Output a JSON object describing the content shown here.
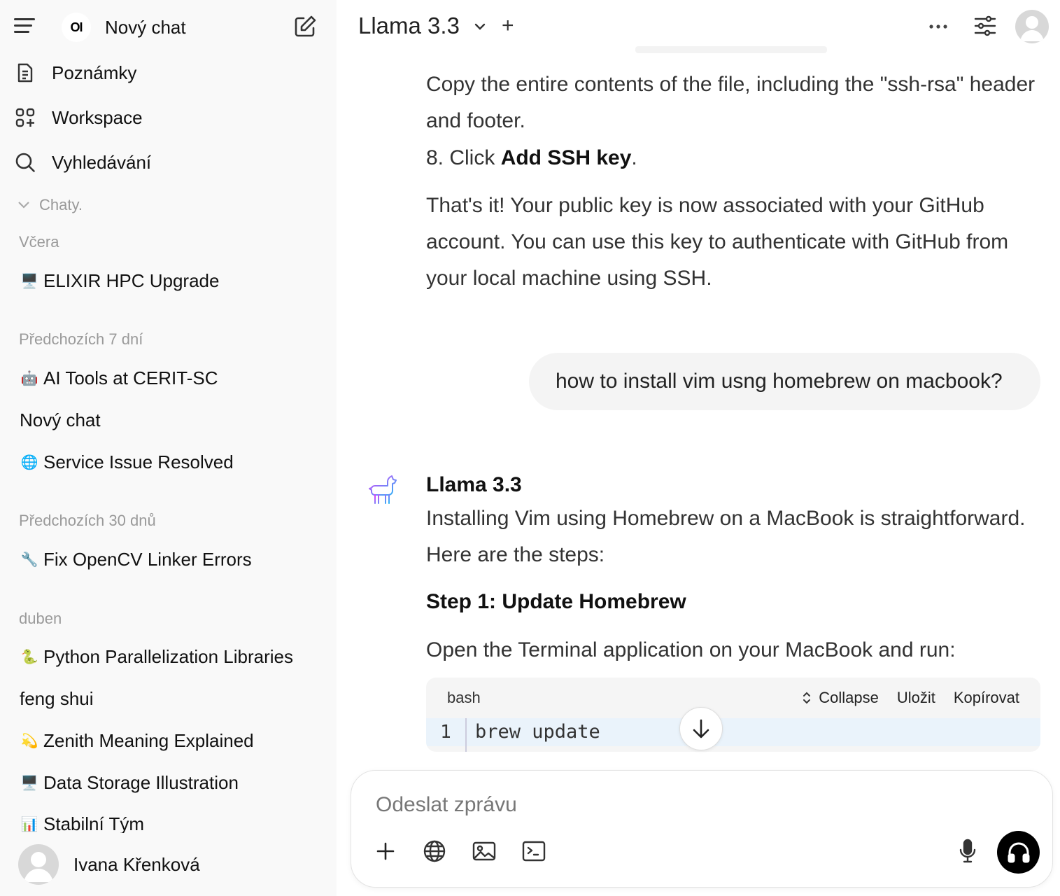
{
  "sidebar": {
    "new_chat_label": "Nový chat",
    "logo_text": "OI",
    "nav": [
      {
        "label": "Poznámky"
      },
      {
        "label": "Workspace"
      },
      {
        "label": "Vyhledávání"
      }
    ],
    "chats_label": "Chaty.",
    "groups": [
      {
        "label": "Včera"
      },
      {
        "label": "Předchozích 7 dní"
      },
      {
        "label": "Předchozích 30 dnů"
      },
      {
        "label": "duben"
      }
    ],
    "chats": [
      {
        "emoji": "🖥️",
        "title": "ELIXIR HPC Upgrade"
      },
      {
        "emoji": "🤖",
        "title": "AI Tools at CERIT-SC"
      },
      {
        "emoji": "",
        "title": "Nový chat"
      },
      {
        "emoji": "🌐",
        "title": "Service Issue Resolved"
      },
      {
        "emoji": "🔧",
        "title": "Fix OpenCV Linker Errors"
      },
      {
        "emoji": "🐍",
        "title": "Python Parallelization Libraries"
      },
      {
        "emoji": "",
        "title": "feng shui"
      },
      {
        "emoji": "💫",
        "title": "Zenith Meaning Explained"
      },
      {
        "emoji": "🖥️",
        "title": "Data Storage Illustration"
      },
      {
        "emoji": "📊",
        "title": "Stabilní Tým"
      }
    ],
    "user_name": "Ivana Křenková"
  },
  "header": {
    "model": "Llama 3.3"
  },
  "conversation": {
    "prev_para1": "Copy the entire contents of the file, including the \"ssh-rsa\" header and footer.",
    "prev_step8_prefix": "8. Click ",
    "prev_step8_bold": "Add SSH key",
    "prev_step8_suffix": ".",
    "prev_para2": "That's it! Your public key is now associated with your GitHub account. You can use this key to authenticate with GitHub from your local machine using SSH.",
    "user_message": "how to install vim usng homebrew on macbook?",
    "assistant_name": "Llama 3.3",
    "assistant_intro": "Installing Vim using Homebrew on a MacBook is straightforward. Here are the steps:",
    "step1_heading": "Step 1: Update Homebrew",
    "step1_text": "Open the Terminal application on your MacBook and run:",
    "code": {
      "lang": "bash",
      "collapse": "Collapse",
      "save": "Uložit",
      "copy": "Kopírovat",
      "line_number": "1",
      "line": "brew update"
    }
  },
  "input": {
    "placeholder": "Odeslat zprávu"
  },
  "colors": {
    "sidebar_bg": "#f9f9f9",
    "bubble_bg": "#f4f4f4",
    "code_bg": "#f5f5f5",
    "code_line_highlight": "#eaf3fb"
  }
}
